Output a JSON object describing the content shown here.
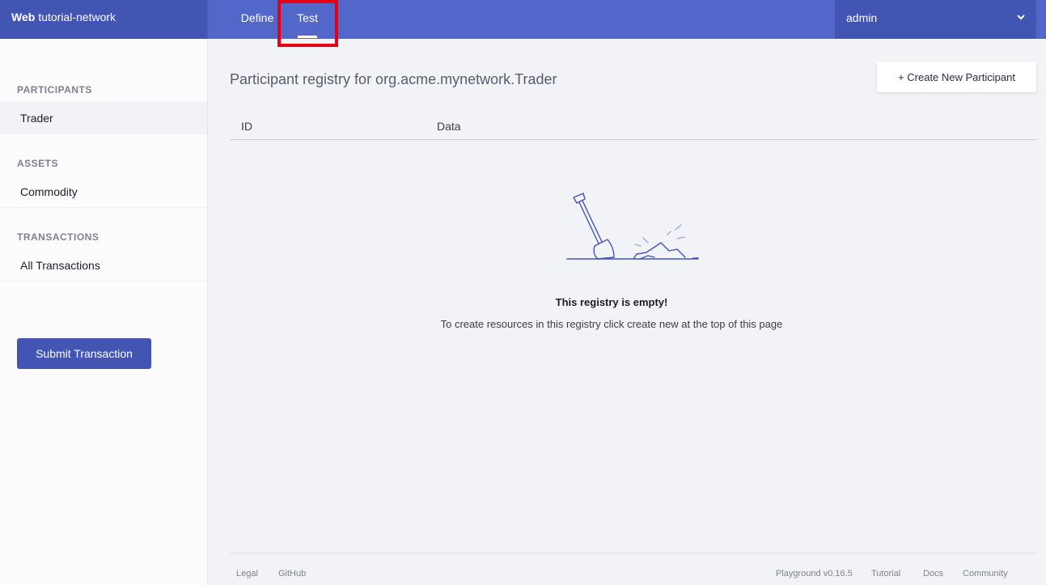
{
  "header": {
    "brand_bold": "Web",
    "brand_name": "tutorial-network",
    "tabs": [
      {
        "label": "Define"
      },
      {
        "label": "Test"
      }
    ],
    "user": "admin"
  },
  "sidebar": {
    "sections": [
      {
        "heading": "PARTICIPANTS",
        "items": [
          {
            "label": "Trader"
          }
        ]
      },
      {
        "heading": "ASSETS",
        "items": [
          {
            "label": "Commodity"
          }
        ]
      },
      {
        "heading": "TRANSACTIONS",
        "items": [
          {
            "label": "All Transactions"
          }
        ]
      }
    ],
    "submit_label": "Submit Transaction"
  },
  "main": {
    "title": "Participant registry for org.acme.mynetwork.Trader",
    "create_label": "+ Create New Participant",
    "columns": [
      "ID",
      "Data"
    ],
    "empty_title": "This registry is empty!",
    "empty_desc": "To create resources in this registry click create new at the top of this page"
  },
  "footer": {
    "left": [
      "Legal",
      "GitHub"
    ],
    "right": [
      "Playground v0.16.5",
      "Tutorial",
      "Docs",
      "Community"
    ]
  },
  "colors": {
    "topbar": "#5267c9",
    "topbar_dark": "#4355b3",
    "highlight": "#e60012"
  },
  "icons": [
    "chevron-down-icon",
    "shovel-illustration"
  ]
}
